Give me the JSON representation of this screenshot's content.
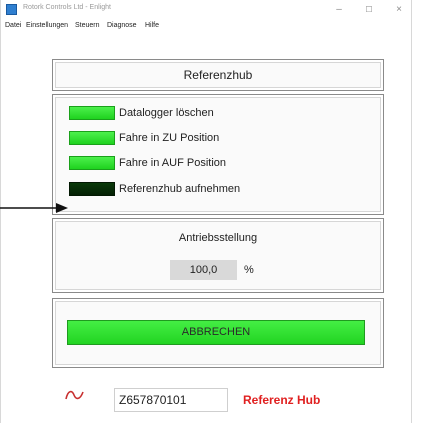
{
  "window": {
    "title": "Rotork Controls Ltd - Enlight",
    "controls": {
      "minimize": "–",
      "maximize": "☐",
      "close": "×"
    }
  },
  "menu": [
    "Datei",
    "Einstellungen",
    "Steuern",
    "Diagnose",
    "Hilfe"
  ],
  "header_panel": {
    "title": "Referenzhub"
  },
  "status_leds": [
    {
      "label": "Datalogger löschen",
      "state": "on"
    },
    {
      "label": "Fahre in ZU Position",
      "state": "on"
    },
    {
      "label": "Fahre in AUF Position",
      "state": "on"
    },
    {
      "label": "Referenzhub aufnehmen",
      "state": "off"
    }
  ],
  "position_panel": {
    "title": "Antriebsstellung",
    "value": "100,0",
    "unit": "%"
  },
  "abort_button": {
    "label": "ABBRECHEN"
  },
  "footer": {
    "icon": "signal-wave-icon",
    "serial": "Z657870101",
    "mode_label": "Referenz Hub"
  },
  "colors": {
    "led_on": "#22dd22",
    "led_off": "#062806",
    "button_green": "#33e033",
    "mode_label_red": "#e02020"
  }
}
